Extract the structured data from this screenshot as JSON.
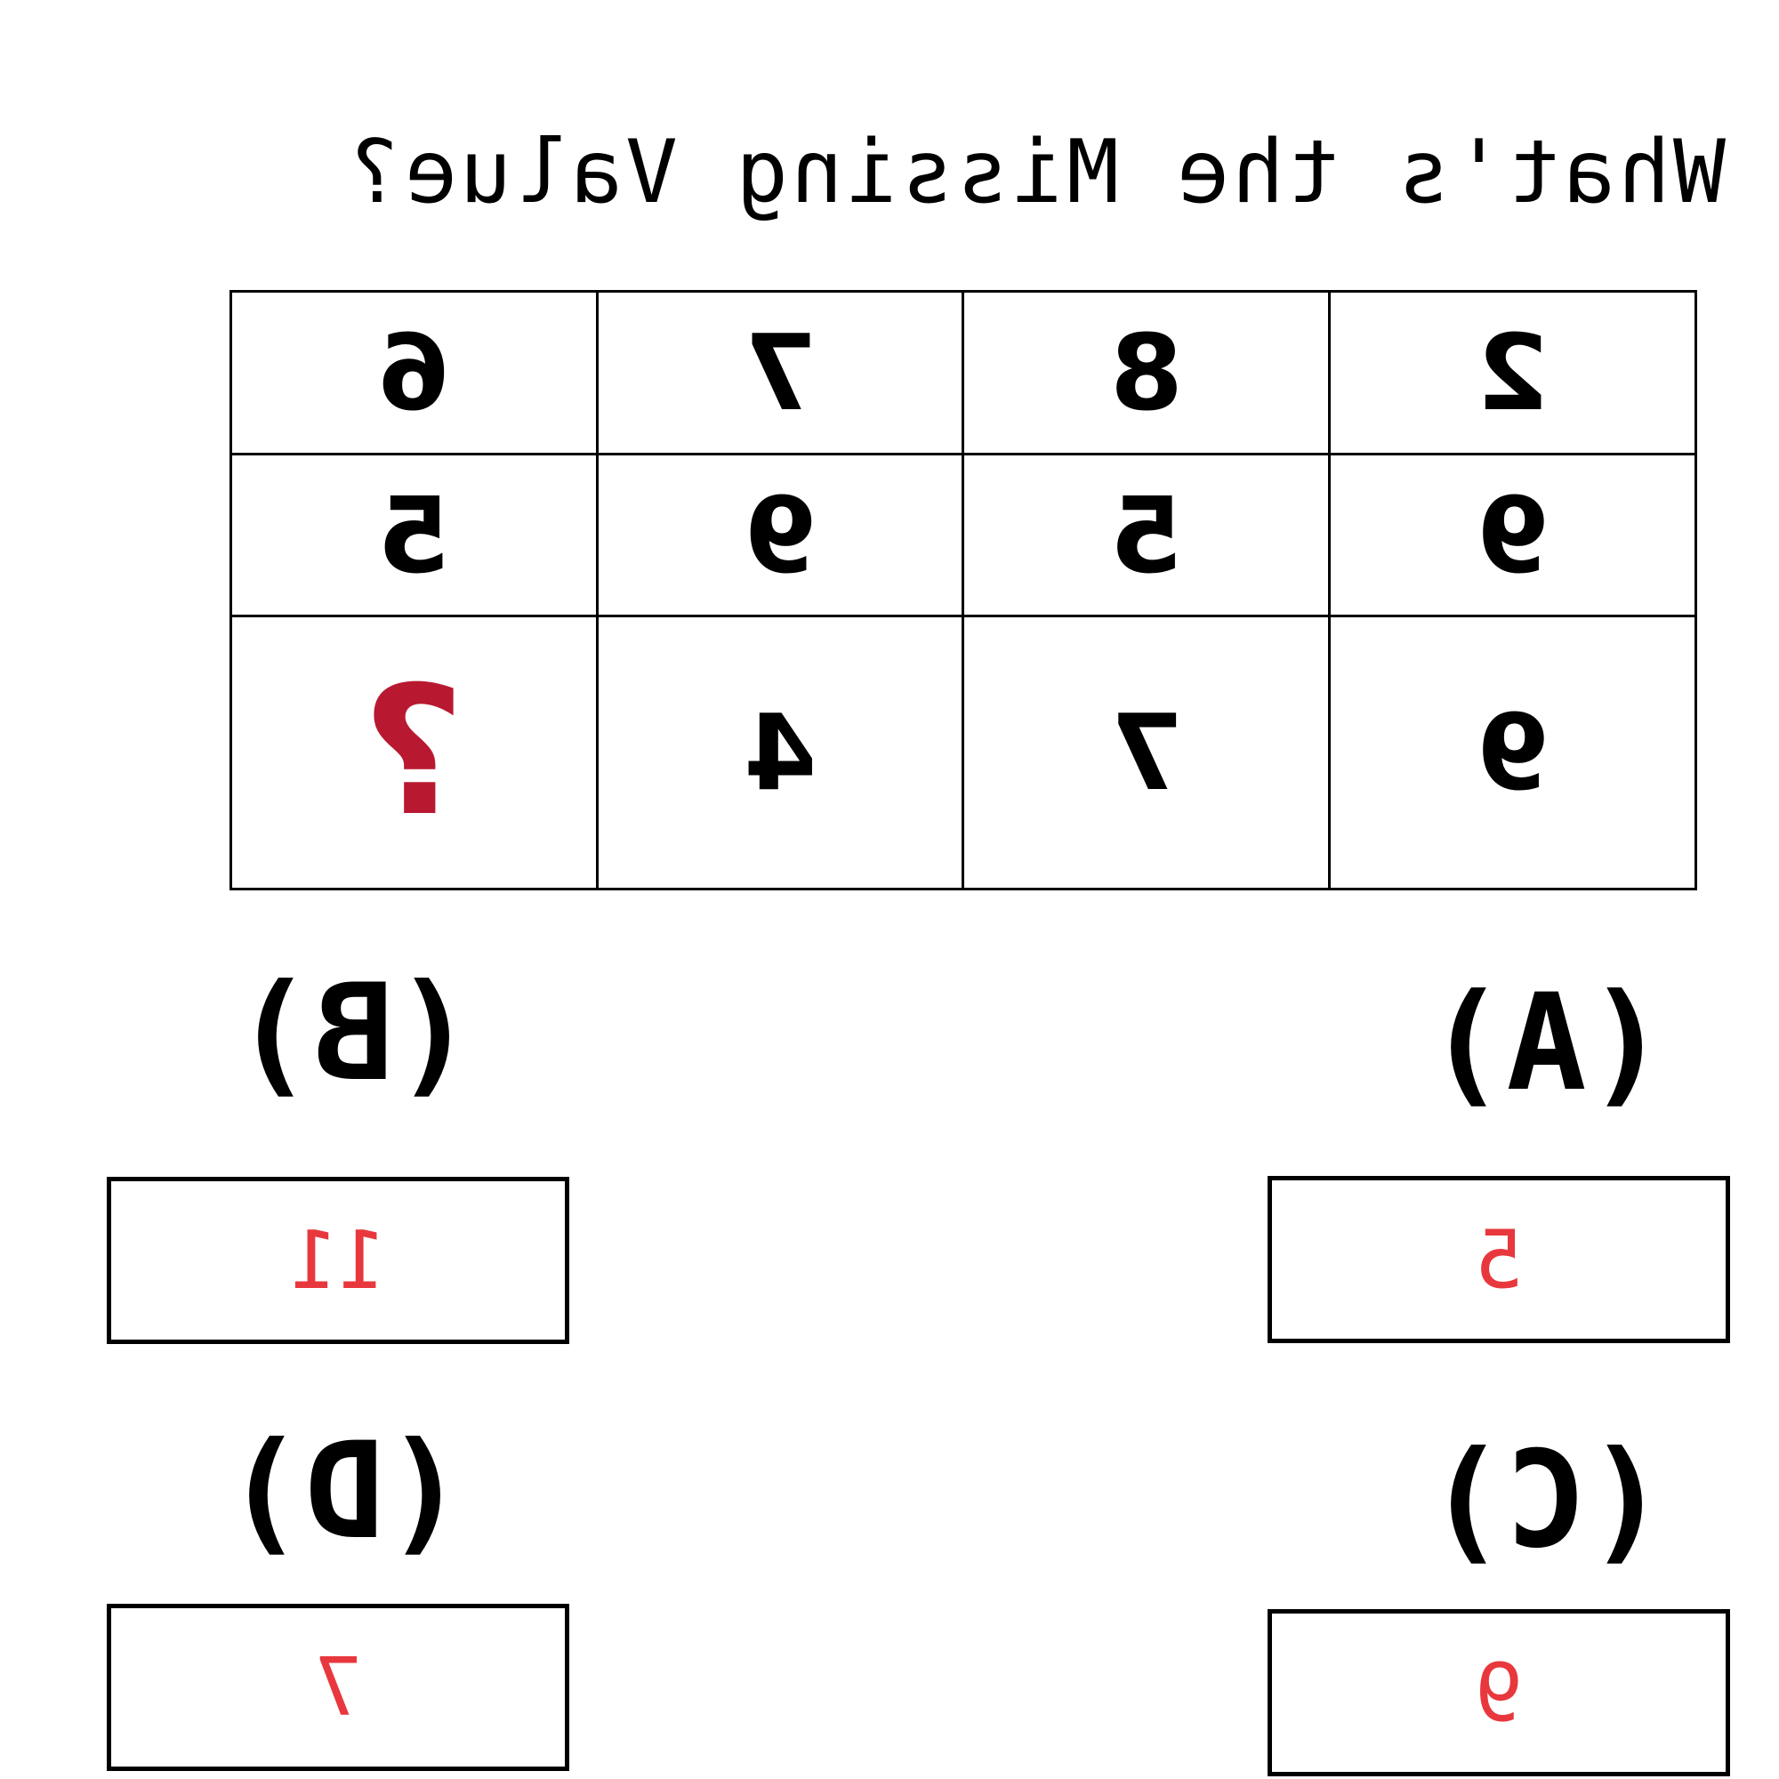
{
  "title": "What's the Missing Value?",
  "grid": {
    "rows": [
      [
        "2",
        "8",
        "7",
        "6"
      ],
      [
        "9",
        "5",
        "9",
        "5"
      ],
      [
        "9",
        "7",
        "4",
        "?"
      ]
    ]
  },
  "options": [
    {
      "label": "(A)",
      "value": "5"
    },
    {
      "label": "(B)",
      "value": "11"
    },
    {
      "label": "(C)",
      "value": "9"
    },
    {
      "label": "(D)",
      "value": "7"
    }
  ],
  "colors": {
    "missing_mark": "#b81931",
    "option_value": "#e8383d",
    "text": "#000000"
  }
}
